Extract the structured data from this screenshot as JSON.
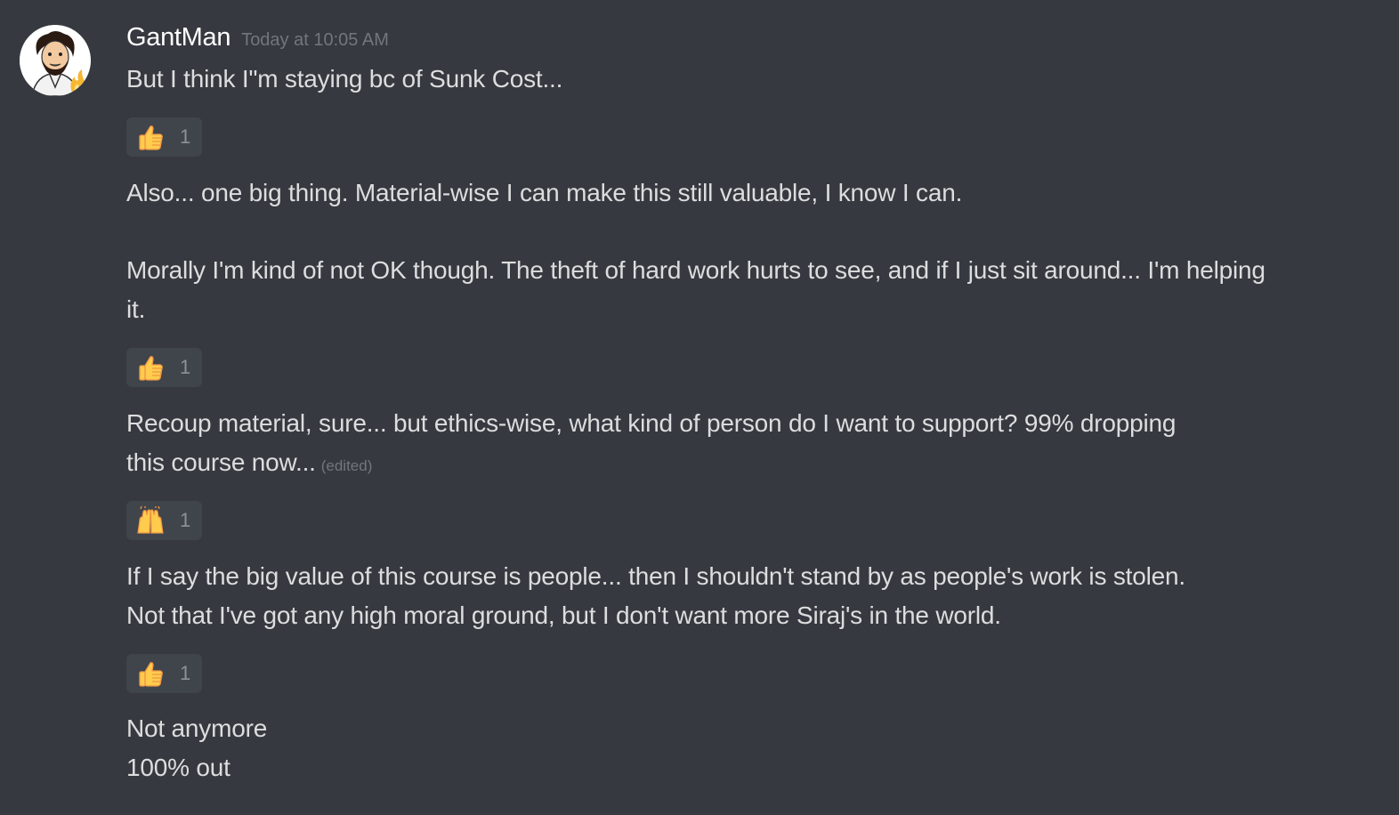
{
  "message": {
    "author": "GantMan",
    "timestamp": "Today at 10:05 AM",
    "avatar_icon": "cartoon-avatar-icon",
    "colors": {
      "background": "#36393f",
      "text": "#dcddde",
      "username": "#ffffff",
      "muted": "#72767d",
      "reaction_bg": "#40444b"
    },
    "lines": {
      "l1": "But I think I\"m staying bc of Sunk Cost...",
      "l2": "Also... one big thing.   Material-wise I can make this still valuable, I know I can.",
      "l3": "Morally I'm kind of not OK though.   The theft of hard work hurts to see, and if I just sit around... I'm helping",
      "l4": "it.",
      "l5": "Recoup material, sure... but ethics-wise, what kind of person do I want to support?  99% dropping",
      "l6": "this course now...",
      "l6_edited": "(edited)",
      "l7": "If I say the big value of this course is people... then I shouldn't stand by as people's work is stolen.",
      "l8": "Not that I've got any high moral ground, but I don't want more Siraj's in the world.",
      "l9": "Not anymore",
      "l10": "100% out"
    },
    "reactions": [
      {
        "icon": "thumbs-up-icon",
        "count": "1"
      },
      {
        "icon": "thumbs-up-icon",
        "count": "1"
      },
      {
        "icon": "raised-hands-icon",
        "count": "1"
      },
      {
        "icon": "thumbs-up-icon",
        "count": "1"
      }
    ]
  }
}
